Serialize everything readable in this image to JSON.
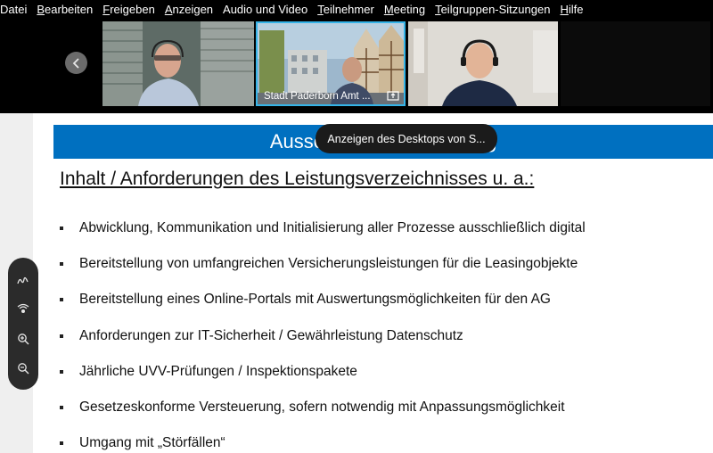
{
  "menu": {
    "items": [
      {
        "label": "Datei",
        "u": "",
        "rest": "Datei"
      },
      {
        "label": "Bearbeiten",
        "u": "B",
        "rest": "earbeiten"
      },
      {
        "label": "Freigeben",
        "u": "F",
        "rest": "reigeben"
      },
      {
        "label": "Anzeigen",
        "u": "A",
        "rest": "nzeigen"
      },
      {
        "label": "Audio und Video",
        "u": "",
        "rest": "Audio und Video"
      },
      {
        "label": "Teilnehmer",
        "u": "T",
        "rest": "eilnehmer"
      },
      {
        "label": "Meeting",
        "u": "M",
        "rest": "eeting"
      },
      {
        "label": "Teilgruppen-Sitzungen",
        "u": "T",
        "rest": "eilgruppen-Sitzungen"
      },
      {
        "label": "Hilfe",
        "u": "H",
        "rest": "ilfe"
      }
    ]
  },
  "videos": {
    "active_tile_name": "Stadt Paderborn Amt ...",
    "accent_color": "#35b4e8"
  },
  "tooltip": {
    "text": "Anzeigen des Desktops von S..."
  },
  "slide": {
    "title": "Ausschreibung IT-Leasing",
    "title_bar_color": "#0070c0",
    "heading": "Inhalt / Anforderungen des Leistungsverzeichnisses u. a.:",
    "bullets": [
      "Abwicklung, Kommunikation und Initialisierung aller Prozesse ausschließlich digital",
      "Bereitstellung von umfangreichen Versicherungsleistungen für die Leasingobjekte",
      "Bereitstellung eines Online-Portals mit Auswertungsmöglichkeiten für den AG",
      "Anforderungen zur IT-Sicherheit / Gewährleistung Datenschutz",
      "Jährliche UVV-Prüfungen / Inspektionspakete",
      "Gesetzeskonforme Versteuerung, sofern notwendig mit Anpassungsmöglichkeit",
      "Umgang mit „Störfällen“"
    ]
  },
  "annotation_tools": [
    {
      "name": "pen-icon"
    },
    {
      "name": "spotlight-icon"
    },
    {
      "name": "zoom-in-icon"
    },
    {
      "name": "zoom-out-icon"
    }
  ]
}
